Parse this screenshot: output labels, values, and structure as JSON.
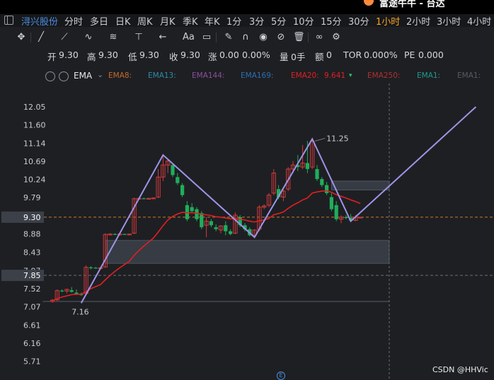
{
  "window": {
    "title": "富途牛牛 - 台达"
  },
  "stock": {
    "name": "浔兴股份"
  },
  "timeframes": [
    "分时",
    "多日",
    "日K",
    "周K",
    "月K",
    "季K",
    "年K",
    "1分",
    "3分",
    "5分",
    "10分",
    "15分",
    "30分",
    "1小时",
    "2小时",
    "3小时",
    "4小时"
  ],
  "active_timeframe": "1小时",
  "toolbar_icons": [
    "crosshair-icon",
    "line-icon",
    "ray-icon",
    "wave-icon",
    "fibonacci-icon",
    "horizontal-line-icon",
    "arrow-icon",
    "text-icon",
    "comment-icon",
    "pencil-icon",
    "magnet-icon",
    "eye-icon",
    "hide-icon",
    "trash-icon",
    "link-icon",
    "settings-icon"
  ],
  "ohlc": {
    "open_label": "开",
    "open": "9.30",
    "high_label": "高",
    "high": "9.30",
    "low_label": "低",
    "low": "9.30",
    "close_label": "收",
    "close": "9.30",
    "change_label": "涨",
    "change": "0.00",
    "change_pct": "0.00%",
    "volume_label": "量",
    "volume": "0手",
    "amount_label": "额",
    "amount": "0",
    "tor_label": "TOR",
    "tor": "0.000%",
    "pe_label": "PE",
    "pe": "0.000"
  },
  "ema": {
    "name": "EMA",
    "items": [
      {
        "label": "EMA8:",
        "value": "",
        "color": "#c56a2b"
      },
      {
        "label": "EMA13:",
        "value": "",
        "color": "#2f8aa6"
      },
      {
        "label": "EMA144:",
        "value": "",
        "color": "#8a4f9e"
      },
      {
        "label": "EMA169:",
        "value": "",
        "color": "#2d6fb3"
      },
      {
        "label": "EMA20:",
        "value": "9.641",
        "color": "#e02020"
      },
      {
        "label": "EMA250:",
        "value": "",
        "color": "#b03030"
      },
      {
        "label": "EMA1:",
        "value": "",
        "color": "#1f9a8a"
      },
      {
        "label": "EMA1:",
        "value": "",
        "color": "#555a62"
      }
    ]
  },
  "watermark": "CSDN @HHVic",
  "chart_data": {
    "type": "candlestick",
    "y_ticks": [
      12.05,
      11.6,
      11.14,
      10.69,
      10.24,
      9.79,
      9.3,
      8.88,
      8.43,
      7.97,
      7.85,
      7.52,
      7.07,
      6.61,
      6.16,
      5.71
    ],
    "price_labels": {
      "current": "9.30",
      "marker": "7.85"
    },
    "candles": [
      {
        "o": 7.2,
        "h": 7.26,
        "l": 7.17,
        "c": 7.23
      },
      {
        "o": 7.24,
        "h": 7.5,
        "l": 7.22,
        "c": 7.47
      },
      {
        "o": 7.47,
        "h": 7.5,
        "l": 7.43,
        "c": 7.46
      },
      {
        "o": 7.46,
        "h": 7.52,
        "l": 7.4,
        "c": 7.5
      },
      {
        "o": 7.48,
        "h": 7.56,
        "l": 7.42,
        "c": 7.44
      },
      {
        "o": 7.42,
        "h": 7.5,
        "l": 7.36,
        "c": 7.38
      },
      {
        "o": 7.38,
        "h": 7.42,
        "l": 7.34,
        "c": 7.36
      },
      {
        "o": 7.4,
        "h": 8.1,
        "l": 7.38,
        "c": 8.05
      },
      {
        "o": 8.05,
        "h": 8.08,
        "l": 8.0,
        "c": 8.04
      },
      {
        "o": 8.04,
        "h": 8.06,
        "l": 8.02,
        "c": 8.03
      },
      {
        "o": 8.03,
        "h": 8.05,
        "l": 8.01,
        "c": 8.04
      },
      {
        "o": 8.06,
        "h": 8.9,
        "l": 8.04,
        "c": 8.87
      },
      {
        "o": 8.87,
        "h": 8.9,
        "l": 8.86,
        "c": 8.88
      },
      {
        "o": 8.88,
        "h": 8.9,
        "l": 8.86,
        "c": 8.87
      },
      {
        "o": 8.87,
        "h": 8.89,
        "l": 8.86,
        "c": 8.88
      },
      {
        "o": 8.88,
        "h": 8.89,
        "l": 8.86,
        "c": 8.87
      },
      {
        "o": 8.87,
        "h": 8.89,
        "l": 8.85,
        "c": 8.88
      },
      {
        "o": 8.9,
        "h": 9.79,
        "l": 8.88,
        "c": 9.76
      },
      {
        "o": 9.76,
        "h": 9.78,
        "l": 9.74,
        "c": 9.77
      },
      {
        "o": 9.77,
        "h": 9.79,
        "l": 9.75,
        "c": 9.76
      },
      {
        "o": 9.76,
        "h": 9.78,
        "l": 9.75,
        "c": 9.77
      },
      {
        "o": 9.77,
        "h": 9.79,
        "l": 9.75,
        "c": 9.78
      },
      {
        "o": 9.8,
        "h": 10.5,
        "l": 9.78,
        "c": 10.3
      },
      {
        "o": 10.3,
        "h": 10.85,
        "l": 10.2,
        "c": 10.6
      },
      {
        "o": 10.6,
        "h": 10.75,
        "l": 10.4,
        "c": 10.7
      },
      {
        "o": 10.6,
        "h": 10.65,
        "l": 10.3,
        "c": 10.35
      },
      {
        "o": 10.3,
        "h": 10.4,
        "l": 10.1,
        "c": 10.15
      },
      {
        "o": 10.1,
        "h": 10.15,
        "l": 9.8,
        "c": 9.85
      },
      {
        "o": 9.6,
        "h": 9.7,
        "l": 9.2,
        "c": 9.25
      },
      {
        "o": 9.55,
        "h": 9.65,
        "l": 9.4,
        "c": 9.45
      },
      {
        "o": 9.5,
        "h": 9.55,
        "l": 9.2,
        "c": 9.25
      },
      {
        "o": 9.4,
        "h": 9.45,
        "l": 9.0,
        "c": 9.05
      },
      {
        "o": 9.1,
        "h": 9.3,
        "l": 8.8,
        "c": 9.2
      },
      {
        "o": 9.2,
        "h": 9.25,
        "l": 9.05,
        "c": 9.1
      },
      {
        "o": 9.05,
        "h": 9.12,
        "l": 8.95,
        "c": 9.0
      },
      {
        "o": 8.98,
        "h": 9.1,
        "l": 8.9,
        "c": 9.08
      },
      {
        "o": 9.1,
        "h": 9.2,
        "l": 8.85,
        "c": 8.95
      },
      {
        "o": 8.95,
        "h": 9.0,
        "l": 8.85,
        "c": 8.88
      },
      {
        "o": 8.9,
        "h": 9.42,
        "l": 8.88,
        "c": 9.35
      },
      {
        "o": 9.3,
        "h": 9.35,
        "l": 9.05,
        "c": 9.1
      },
      {
        "o": 9.1,
        "h": 9.15,
        "l": 8.95,
        "c": 9.0
      },
      {
        "o": 9.0,
        "h": 9.05,
        "l": 8.82,
        "c": 8.85
      },
      {
        "o": 8.85,
        "h": 9.0,
        "l": 8.8,
        "c": 8.98
      },
      {
        "o": 9.0,
        "h": 9.6,
        "l": 8.95,
        "c": 9.55
      },
      {
        "o": 9.55,
        "h": 9.62,
        "l": 9.5,
        "c": 9.58
      },
      {
        "o": 9.6,
        "h": 9.9,
        "l": 9.55,
        "c": 9.85
      },
      {
        "o": 9.9,
        "h": 10.5,
        "l": 9.85,
        "c": 10.4
      },
      {
        "o": 10.0,
        "h": 10.1,
        "l": 9.75,
        "c": 9.8
      },
      {
        "o": 9.8,
        "h": 10.05,
        "l": 9.7,
        "c": 9.95
      },
      {
        "o": 10.0,
        "h": 10.55,
        "l": 9.95,
        "c": 10.5
      },
      {
        "o": 10.5,
        "h": 10.7,
        "l": 10.4,
        "c": 10.6
      },
      {
        "o": 10.6,
        "h": 10.85,
        "l": 10.45,
        "c": 10.55
      },
      {
        "o": 10.55,
        "h": 11.1,
        "l": 10.5,
        "c": 10.65
      },
      {
        "o": 10.65,
        "h": 11.2,
        "l": 10.4,
        "c": 10.5
      },
      {
        "o": 10.55,
        "h": 11.25,
        "l": 10.5,
        "c": 11.2
      },
      {
        "o": 10.5,
        "h": 10.6,
        "l": 10.2,
        "c": 10.25
      },
      {
        "o": 10.25,
        "h": 10.3,
        "l": 10.05,
        "c": 10.1
      },
      {
        "o": 10.1,
        "h": 10.18,
        "l": 9.85,
        "c": 9.9
      },
      {
        "o": 9.8,
        "h": 9.9,
        "l": 9.45,
        "c": 9.5
      },
      {
        "o": 9.6,
        "h": 9.7,
        "l": 9.2,
        "c": 9.25
      },
      {
        "o": 9.25,
        "h": 9.35,
        "l": 9.15,
        "c": 9.3
      },
      {
        "o": 9.3,
        "h": 9.35,
        "l": 9.25,
        "c": 9.28
      },
      {
        "o": 9.28,
        "h": 9.38,
        "l": 9.18,
        "c": 9.22
      },
      {
        "o": 9.22,
        "h": 9.35,
        "l": 9.2,
        "c": 9.3
      },
      {
        "o": 9.3,
        "h": 9.3,
        "l": 9.3,
        "c": 9.3
      }
    ],
    "ema20": [
      7.22,
      7.27,
      7.31,
      7.34,
      7.37,
      7.38,
      7.38,
      7.45,
      7.52,
      7.57,
      7.62,
      7.74,
      7.85,
      7.95,
      8.04,
      8.12,
      8.2,
      8.35,
      8.47,
      8.58,
      8.68,
      8.78,
      8.93,
      9.09,
      9.23,
      9.32,
      9.38,
      9.42,
      9.41,
      9.41,
      9.4,
      9.37,
      9.36,
      9.34,
      9.31,
      9.3,
      9.28,
      9.26,
      9.26,
      9.25,
      9.23,
      9.2,
      9.18,
      9.21,
      9.23,
      9.27,
      9.36,
      9.39,
      9.43,
      9.52,
      9.6,
      9.66,
      9.73,
      9.78,
      9.9,
      9.93,
      9.95,
      9.96,
      9.92,
      9.86,
      9.82,
      9.78,
      9.73,
      9.69,
      9.64
    ],
    "zigzag": [
      {
        "i": 6,
        "price": 7.16
      },
      {
        "i": 23,
        "price": 10.85
      },
      {
        "i": 42,
        "price": 8.8
      },
      {
        "i": 54,
        "price": 11.25
      },
      {
        "i": 62,
        "price": 9.2
      },
      {
        "i": 88,
        "price": 12.05
      }
    ],
    "labels": [
      {
        "text": "7.16"
      },
      {
        "text": "11.25"
      }
    ],
    "zones": [
      {
        "from_i": 11,
        "to_i": 70,
        "high": 8.72,
        "low": 8.15
      },
      {
        "from_i": 58,
        "to_i": 70,
        "high": 10.2,
        "low": 9.98
      }
    ],
    "hlines": [
      {
        "price": 7.2,
        "style": "solid",
        "color": "#5a5e66"
      },
      {
        "price": 9.3,
        "style": "dashed",
        "color": "#c87a2b"
      },
      {
        "price": 7.85,
        "style": "dashed",
        "color": "#6a6e76"
      }
    ],
    "crosshair_i": 70
  }
}
